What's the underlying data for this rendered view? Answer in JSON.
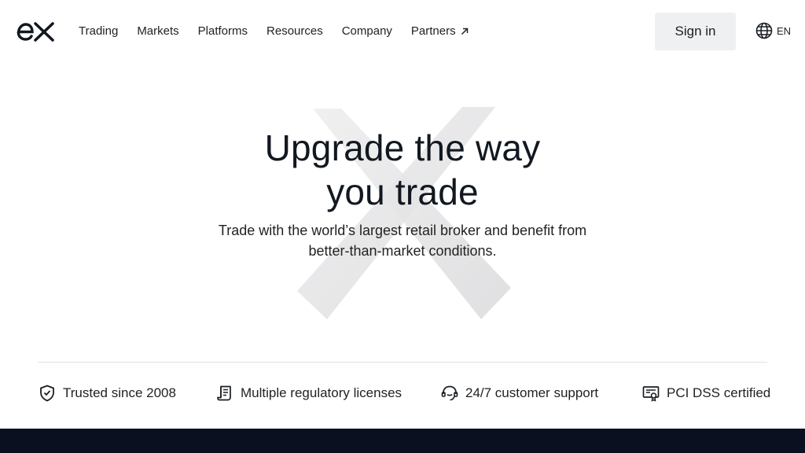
{
  "header": {
    "logo_text": "ex",
    "nav": [
      {
        "label": "Trading"
      },
      {
        "label": "Markets"
      },
      {
        "label": "Platforms"
      },
      {
        "label": "Resources"
      },
      {
        "label": "Company"
      },
      {
        "label": "Partners",
        "external": true
      }
    ],
    "sign_in_label": "Sign in",
    "language": "EN"
  },
  "hero": {
    "title_line1": "Upgrade the way",
    "title_line2": "you trade",
    "subtitle_line1": "Trade with the world’s largest retail broker and benefit from",
    "subtitle_line2": "better-than-market conditions."
  },
  "features": [
    {
      "icon": "shield-check-icon",
      "label": "Trusted since 2008"
    },
    {
      "icon": "scroll-document-icon",
      "label": "Multiple regulatory licenses"
    },
    {
      "icon": "headset-support-icon",
      "label": "24/7 customer support"
    },
    {
      "icon": "certificate-icon",
      "label": "PCI DSS certified"
    }
  ],
  "colors": {
    "text": "#121820",
    "signin_bg": "#eef0f2",
    "footer_bg": "#0b1020",
    "divider": "#dde0e3"
  }
}
